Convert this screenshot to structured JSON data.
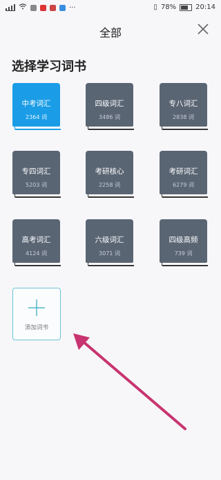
{
  "status_bar": {
    "battery": "78%",
    "time": "20:14",
    "icons": [
      "signal-icon",
      "wifi-icon",
      "app-icon",
      "app-icon",
      "app-icon",
      "app-icon",
      "more-icon",
      "vibrate-icon",
      "battery-icon"
    ]
  },
  "header": {
    "title": "全部",
    "close_icon": "close-icon"
  },
  "section": {
    "title": "选择学习词书"
  },
  "books": [
    {
      "name": "中考词汇",
      "count": "2364 词",
      "selected": true
    },
    {
      "name": "四级词汇",
      "count": "3486 词",
      "selected": false
    },
    {
      "name": "专八词汇",
      "count": "2838 词",
      "selected": false
    },
    {
      "name": "专四词汇",
      "count": "5203 词",
      "selected": false
    },
    {
      "name": "考研核心",
      "count": "2258 词",
      "selected": false
    },
    {
      "name": "考研词汇",
      "count": "6279 词",
      "selected": false
    },
    {
      "name": "高考词汇",
      "count": "4124 词",
      "selected": false
    },
    {
      "name": "六级词汇",
      "count": "3071 词",
      "selected": false
    },
    {
      "name": "四级高频",
      "count": "739 词",
      "selected": false
    }
  ],
  "add_book": {
    "label": "添加词书",
    "icon": "plus-icon"
  },
  "colors": {
    "active_book": "#1a9de6",
    "book": "#5a6573",
    "add_border": "#6cc3d6",
    "arrow": "#c8346f"
  }
}
